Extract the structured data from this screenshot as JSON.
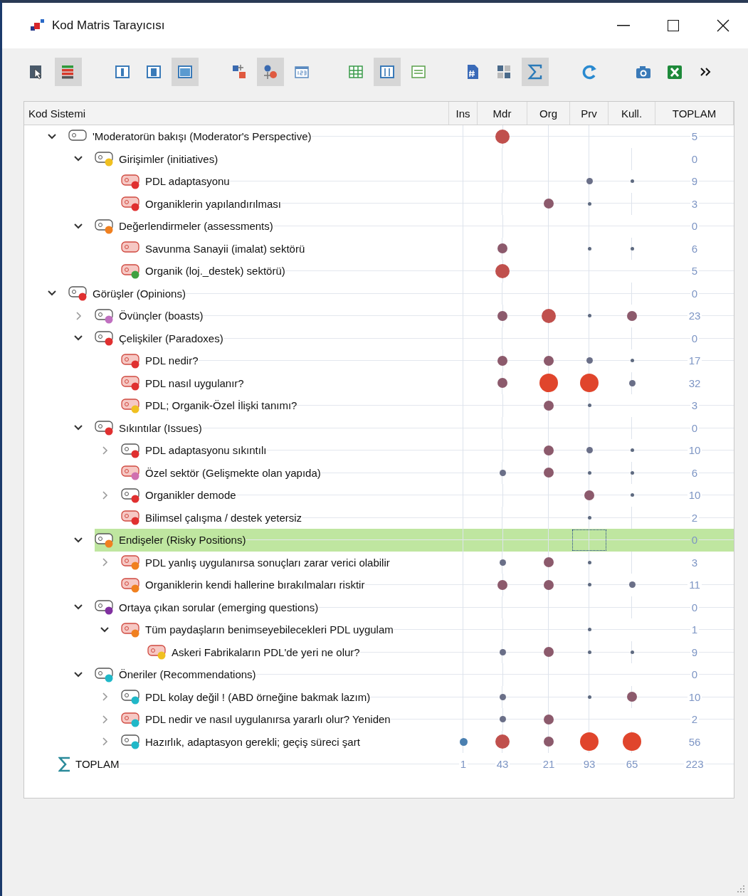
{
  "window": {
    "title": "Kod Matris Tarayıcısı"
  },
  "toolbar": [
    {
      "selected": false
    },
    {
      "selected": true
    },
    {
      "selected": false
    },
    {
      "selected": false
    },
    {
      "selected": true
    },
    {
      "selected": false
    },
    {
      "selected": true
    },
    {
      "selected": false
    },
    {
      "selected": false
    },
    {
      "selected": true
    },
    {
      "selected": false
    },
    {
      "selected": false
    },
    {
      "selected": false
    },
    {
      "selected": true
    },
    {
      "selected": false
    },
    {
      "selected": false
    },
    {
      "selected": false
    },
    {
      "selected": false
    }
  ],
  "table": {
    "columns": [
      "Kod Sistemi",
      "Ins",
      "Mdr",
      "Org",
      "Prv",
      "Kull.",
      "TOPLAM"
    ],
    "rows": [
      {
        "label": "'Moderatorün bakışı (Moderator's Perspective)",
        "tinted": false,
        "expanded": true,
        "selected": false,
        "cells": [
          {
            "kind": "empty"
          },
          {
            "kind": "large"
          },
          {
            "kind": "empty"
          },
          {
            "kind": "empty"
          },
          {
            "kind": "empty"
          }
        ],
        "total": "5",
        "children": [
          {
            "label": "Girişimler (initiatives)",
            "tinted": false,
            "color": "#f0c020",
            "expanded": true,
            "selected": false,
            "cells": [
              {
                "kind": "empty"
              },
              {
                "kind": "empty"
              },
              {
                "kind": "empty"
              },
              {
                "kind": "empty"
              },
              {
                "kind": "empty"
              }
            ],
            "total": "0",
            "children": [
              {
                "label": "PDL adaptasyonu",
                "tinted": true,
                "color": "#e03030",
                "selected": false,
                "cells": [
                  {
                    "kind": "empty"
                  },
                  {
                    "kind": "empty"
                  },
                  {
                    "kind": "empty"
                  },
                  {
                    "kind": "small"
                  },
                  {
                    "kind": "tiny"
                  }
                ],
                "total": "9"
              },
              {
                "label": "Organiklerin yapılandırılması",
                "tinted": true,
                "color": "#e03030",
                "selected": false,
                "cells": [
                  {
                    "kind": "empty"
                  },
                  {
                    "kind": "empty"
                  },
                  {
                    "kind": "medium"
                  },
                  {
                    "kind": "tiny"
                  },
                  {
                    "kind": "empty"
                  }
                ],
                "total": "3"
              }
            ]
          },
          {
            "label": "Değerlendirmeler (assessments)",
            "tinted": false,
            "color": "#f08020",
            "expanded": true,
            "selected": false,
            "cells": [
              {
                "kind": "empty"
              },
              {
                "kind": "empty"
              },
              {
                "kind": "empty"
              },
              {
                "kind": "empty"
              },
              {
                "kind": "empty"
              }
            ],
            "total": "0",
            "children": [
              {
                "label": "Savunma Sanayii (imalat) sektörü",
                "tinted": true,
                "selected": false,
                "cells": [
                  {
                    "kind": "empty"
                  },
                  {
                    "kind": "medium"
                  },
                  {
                    "kind": "empty"
                  },
                  {
                    "kind": "tiny"
                  },
                  {
                    "kind": "tiny"
                  }
                ],
                "total": "6"
              },
              {
                "label": "Organik (loj._destek) sektörü)",
                "tinted": true,
                "color": "#40a040",
                "selected": false,
                "cells": [
                  {
                    "kind": "empty"
                  },
                  {
                    "kind": "large"
                  },
                  {
                    "kind": "empty"
                  },
                  {
                    "kind": "empty"
                  },
                  {
                    "kind": "empty"
                  }
                ],
                "total": "5"
              }
            ]
          }
        ]
      },
      {
        "label": "Görüşler (Opinions)",
        "tinted": false,
        "color": "#e03030",
        "expanded": true,
        "selected": false,
        "cells": [
          {
            "kind": "empty"
          },
          {
            "kind": "empty"
          },
          {
            "kind": "empty"
          },
          {
            "kind": "empty"
          },
          {
            "kind": "empty"
          }
        ],
        "total": "0",
        "children": [
          {
            "label": "Övünçler (boasts)",
            "tinted": false,
            "color": "#c070c0",
            "expanded": false,
            "selected": false,
            "cells": [
              {
                "kind": "empty"
              },
              {
                "kind": "medium"
              },
              {
                "kind": "large"
              },
              {
                "kind": "tiny"
              },
              {
                "kind": "medium"
              }
            ],
            "total": "23"
          },
          {
            "label": "Çelişkiler (Paradoxes)",
            "tinted": false,
            "color": "#e03030",
            "expanded": true,
            "selected": false,
            "cells": [
              {
                "kind": "empty"
              },
              {
                "kind": "empty"
              },
              {
                "kind": "empty"
              },
              {
                "kind": "empty"
              },
              {
                "kind": "empty"
              }
            ],
            "total": "0",
            "children": [
              {
                "label": "PDL nedir?",
                "tinted": true,
                "color": "#e03030",
                "selected": false,
                "cells": [
                  {
                    "kind": "empty"
                  },
                  {
                    "kind": "medium"
                  },
                  {
                    "kind": "medium"
                  },
                  {
                    "kind": "small"
                  },
                  {
                    "kind": "tiny"
                  }
                ],
                "total": "17"
              },
              {
                "label": "PDL nasıl uygulanır?",
                "tinted": true,
                "color": "#e03030",
                "selected": false,
                "cells": [
                  {
                    "kind": "empty"
                  },
                  {
                    "kind": "medium"
                  },
                  {
                    "kind": "huge"
                  },
                  {
                    "kind": "huge"
                  },
                  {
                    "kind": "small"
                  }
                ],
                "total": "32"
              },
              {
                "label": "PDL; Organik-Özel İlişki tanımı?",
                "tinted": true,
                "color": "#f0c020",
                "selected": false,
                "cells": [
                  {
                    "kind": "empty"
                  },
                  {
                    "kind": "empty"
                  },
                  {
                    "kind": "medium"
                  },
                  {
                    "kind": "tiny"
                  },
                  {
                    "kind": "empty"
                  }
                ],
                "total": "3"
              }
            ]
          },
          {
            "label": "Sıkıntılar (Issues)",
            "tinted": false,
            "color": "#e03030",
            "expanded": true,
            "selected": false,
            "cells": [
              {
                "kind": "empty"
              },
              {
                "kind": "empty"
              },
              {
                "kind": "empty"
              },
              {
                "kind": "empty"
              },
              {
                "kind": "empty"
              }
            ],
            "total": "0",
            "children": [
              {
                "label": "PDL adaptasyonu sıkıntılı",
                "tinted": false,
                "color": "#e03030",
                "expanded": false,
                "selected": false,
                "cells": [
                  {
                    "kind": "empty"
                  },
                  {
                    "kind": "empty"
                  },
                  {
                    "kind": "medium"
                  },
                  {
                    "kind": "small"
                  },
                  {
                    "kind": "tiny"
                  }
                ],
                "total": "10"
              },
              {
                "label": "Özel sektör (Gelişmekte olan yapıda)",
                "tinted": true,
                "color": "#d070b0",
                "selected": false,
                "cells": [
                  {
                    "kind": "empty"
                  },
                  {
                    "kind": "small"
                  },
                  {
                    "kind": "medium"
                  },
                  {
                    "kind": "tiny"
                  },
                  {
                    "kind": "tiny"
                  }
                ],
                "total": "6"
              },
              {
                "label": "Organikler demode",
                "tinted": false,
                "color": "#e03030",
                "expanded": false,
                "selected": false,
                "cells": [
                  {
                    "kind": "empty"
                  },
                  {
                    "kind": "empty"
                  },
                  {
                    "kind": "empty"
                  },
                  {
                    "kind": "medium"
                  },
                  {
                    "kind": "tiny"
                  }
                ],
                "total": "10"
              },
              {
                "label": "Bilimsel çalışma / destek yetersiz",
                "tinted": true,
                "color": "#e03030",
                "selected": false,
                "cells": [
                  {
                    "kind": "empty"
                  },
                  {
                    "kind": "empty"
                  },
                  {
                    "kind": "empty"
                  },
                  {
                    "kind": "tiny"
                  },
                  {
                    "kind": "empty"
                  }
                ],
                "total": "2"
              }
            ]
          },
          {
            "label": "Endişeler (Risky Positions)",
            "tinted": false,
            "color": "#f08020",
            "expanded": true,
            "selected": true,
            "cells": [
              {
                "kind": "empty"
              },
              {
                "kind": "empty"
              },
              {
                "kind": "empty"
              },
              {
                "kind": "empty",
                "focused": true
              },
              {
                "kind": "empty"
              }
            ],
            "total": "0",
            "children": [
              {
                "label": "PDL yanlış uygulanırsa sonuçları zarar verici olabilir",
                "tinted": true,
                "color": "#f08020",
                "expanded": false,
                "selected": false,
                "cells": [
                  {
                    "kind": "empty"
                  },
                  {
                    "kind": "small"
                  },
                  {
                    "kind": "medium"
                  },
                  {
                    "kind": "tiny"
                  },
                  {
                    "kind": "empty"
                  }
                ],
                "total": "3"
              },
              {
                "label": "Organiklerin kendi hallerine bırakılmaları risktir",
                "tinted": true,
                "color": "#f08020",
                "selected": false,
                "cells": [
                  {
                    "kind": "empty"
                  },
                  {
                    "kind": "medium"
                  },
                  {
                    "kind": "medium"
                  },
                  {
                    "kind": "tiny"
                  },
                  {
                    "kind": "small"
                  }
                ],
                "total": "11"
              }
            ]
          },
          {
            "label": "Ortaya çıkan sorular (emerging questions)",
            "tinted": false,
            "color": "#8030a0",
            "expanded": true,
            "selected": false,
            "cells": [
              {
                "kind": "empty"
              },
              {
                "kind": "empty"
              },
              {
                "kind": "empty"
              },
              {
                "kind": "empty"
              },
              {
                "kind": "empty"
              }
            ],
            "total": "0",
            "children": [
              {
                "label": "Tüm paydaşların benimseyebilecekleri PDL uygulam",
                "tinted": true,
                "color": "#f08020",
                "expanded": true,
                "selected": false,
                "cells": [
                  {
                    "kind": "empty"
                  },
                  {
                    "kind": "empty"
                  },
                  {
                    "kind": "empty"
                  },
                  {
                    "kind": "tiny"
                  },
                  {
                    "kind": "empty"
                  }
                ],
                "total": "1",
                "children": [
                  {
                    "label": "Askeri Fabrikaların PDL'de yeri ne olur?",
                    "tinted": true,
                    "color": "#f0c020",
                    "selected": false,
                    "cells": [
                      {
                        "kind": "empty"
                      },
                      {
                        "kind": "small"
                      },
                      {
                        "kind": "medium"
                      },
                      {
                        "kind": "tiny"
                      },
                      {
                        "kind": "tiny"
                      }
                    ],
                    "total": "9"
                  }
                ]
              }
            ]
          },
          {
            "label": "Öneriler (Recommendations)",
            "tinted": false,
            "color": "#20b8c8",
            "expanded": true,
            "selected": false,
            "cells": [
              {
                "kind": "empty"
              },
              {
                "kind": "empty"
              },
              {
                "kind": "empty"
              },
              {
                "kind": "empty"
              },
              {
                "kind": "empty"
              }
            ],
            "total": "0",
            "children": [
              {
                "label": "PDL kolay değil ! (ABD örneğine bakmak lazım)",
                "tinted": false,
                "color": "#20b8c8",
                "expanded": false,
                "selected": false,
                "cells": [
                  {
                    "kind": "empty"
                  },
                  {
                    "kind": "small"
                  },
                  {
                    "kind": "empty"
                  },
                  {
                    "kind": "tiny"
                  },
                  {
                    "kind": "medium"
                  }
                ],
                "total": "10"
              },
              {
                "label": "PDL nedir ve nasıl uygulanırsa yararlı olur? Yeniden",
                "tinted": true,
                "color": "#20b8c8",
                "expanded": false,
                "selected": false,
                "cells": [
                  {
                    "kind": "empty"
                  },
                  {
                    "kind": "small"
                  },
                  {
                    "kind": "medium"
                  },
                  {
                    "kind": "empty"
                  },
                  {
                    "kind": "empty"
                  }
                ],
                "total": "2"
              },
              {
                "label": "Hazırlık, adaptasyon gerekli; geçiş süreci şart",
                "tinted": false,
                "color": "#20b8c8",
                "expanded": false,
                "selected": false,
                "cells": [
                  {
                    "kind": "blue"
                  },
                  {
                    "kind": "large"
                  },
                  {
                    "kind": "medium"
                  },
                  {
                    "kind": "huge"
                  },
                  {
                    "kind": "huge"
                  }
                ],
                "total": "56"
              }
            ]
          }
        ]
      }
    ],
    "totals": {
      "label": "TOPLAM",
      "values": [
        "1",
        "43",
        "21",
        "93",
        "65"
      ],
      "total": "223"
    }
  }
}
